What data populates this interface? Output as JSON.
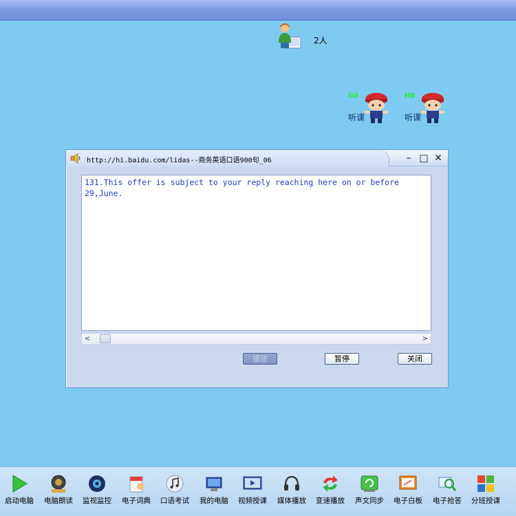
{
  "teacher": {
    "count_label": "2人"
  },
  "students": [
    {
      "seat": "G8",
      "status": "听课"
    },
    {
      "seat": "H8",
      "status": "听课"
    }
  ],
  "dialog": {
    "title": "http://hi.baidu.com/lidas--商务英语口语900句_06",
    "content": "131.This offer is subject to your reply reaching here on or before 29,June.",
    "buttons": {
      "play": "播放",
      "pause": "暂停",
      "close": "关闭"
    }
  },
  "toolbar": {
    "items": [
      {
        "label": "启动电脑"
      },
      {
        "label": "电脑朗读"
      },
      {
        "label": "监视监控"
      },
      {
        "label": "电子词典"
      },
      {
        "label": "口语考试"
      },
      {
        "label": "我的电脑"
      },
      {
        "label": "视频授课"
      },
      {
        "label": "媒体播放"
      },
      {
        "label": "变速播放"
      },
      {
        "label": "声文同步"
      },
      {
        "label": "电子白板"
      },
      {
        "label": "电子抢答"
      },
      {
        "label": "分班授课"
      }
    ]
  }
}
